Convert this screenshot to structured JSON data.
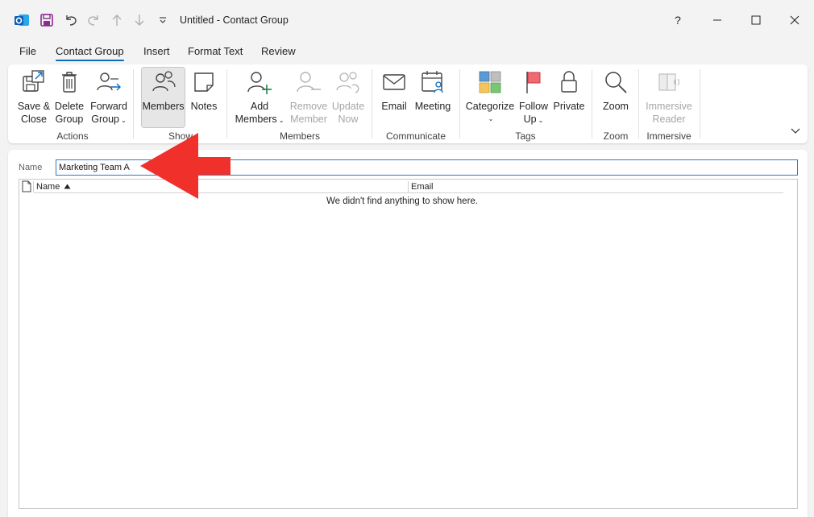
{
  "window": {
    "title": "Untitled  -  Contact Group",
    "help": "?",
    "colors": {
      "accent": "#0f6cbd",
      "outlook_blue": "#0a5fb4",
      "save_purple": "#8b2d8f",
      "annotation_red": "#f0302b"
    }
  },
  "quick_access": {
    "icons": [
      "outlook-app-icon",
      "save-icon",
      "undo-icon",
      "redo-icon",
      "up-arrow-icon",
      "down-arrow-icon",
      "customize-dropdown-icon"
    ]
  },
  "tabs": [
    {
      "label": "File"
    },
    {
      "label": "Contact Group",
      "active": true
    },
    {
      "label": "Insert"
    },
    {
      "label": "Format Text"
    },
    {
      "label": "Review"
    }
  ],
  "ribbon": {
    "save_close": {
      "line1": "Save &",
      "line2": "Close"
    },
    "delete_group": {
      "line1": "Delete",
      "line2": "Group"
    },
    "forward_group": {
      "line1": "Forward",
      "line2": "Group"
    },
    "actions_label": "Actions",
    "members_view": {
      "line1": "Members"
    },
    "notes": {
      "line1": "Notes"
    },
    "show_label": "Show",
    "add_members": {
      "line1": "Add",
      "line2": "Members"
    },
    "remove_member": {
      "line1": "Remove",
      "line2": "Member"
    },
    "update_now": {
      "line1": "Update",
      "line2": "Now"
    },
    "members_label": "Members",
    "email": {
      "line1": "Email"
    },
    "meeting": {
      "line1": "Meeting"
    },
    "communicate_label": "Communicate",
    "categorize": {
      "line1": "Categorize"
    },
    "follow_up": {
      "line1": "Follow",
      "line2": "Up"
    },
    "private": {
      "line1": "Private"
    },
    "tags_label": "Tags",
    "zoom": {
      "line1": "Zoom"
    },
    "zoom_label": "Zoom",
    "immersive_reader": {
      "line1": "Immersive",
      "line2": "Reader"
    },
    "immersive_label": "Immersive"
  },
  "form": {
    "name_label": "Name",
    "name_value": "Marketing Team A",
    "columns": {
      "name": "Name",
      "email": "Email"
    },
    "empty_message": "We didn't find anything to show here."
  }
}
